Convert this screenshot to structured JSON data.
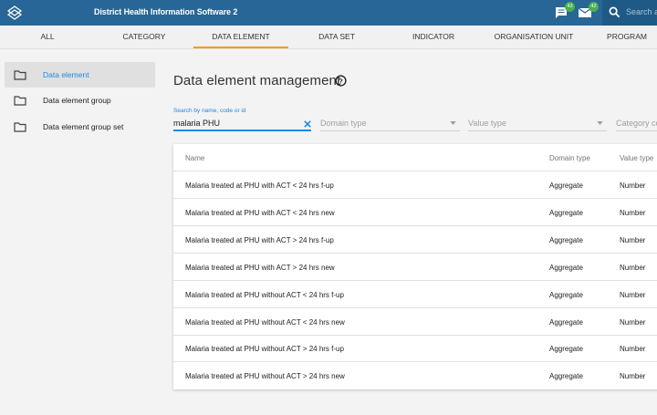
{
  "header": {
    "title": "District Health Information Software 2",
    "messages_badge": "43",
    "interpretations_badge": "42",
    "search_placeholder": "Search apps",
    "logo_icon": "dhis2-logo-icon",
    "messages_icon": "chat-icon",
    "mail_icon": "mail-icon"
  },
  "tabs": [
    {
      "label": "ALL"
    },
    {
      "label": "CATEGORY"
    },
    {
      "label": "DATA ELEMENT"
    },
    {
      "label": "DATA SET"
    },
    {
      "label": "INDICATOR"
    },
    {
      "label": "ORGANISATION UNIT"
    },
    {
      "label": "PROGRAM"
    }
  ],
  "sidebar": {
    "items": [
      {
        "label": "Data element",
        "active": true
      },
      {
        "label": "Data element group"
      },
      {
        "label": "Data element group set"
      }
    ]
  },
  "main": {
    "title": "Data element management",
    "search_label": "Search by name, code or id",
    "search_value": "malaria PHU",
    "filters": {
      "domain_type": "Domain type",
      "value_type": "Value type",
      "category_combo": "Category combo"
    },
    "table": {
      "headers": {
        "name": "Name",
        "domain_type": "Domain type",
        "value_type": "Value type"
      },
      "rows": [
        {
          "name": "Malaria treated at PHU with ACT < 24 hrs f-up",
          "domain_type": "Aggregate",
          "value_type": "Number"
        },
        {
          "name": "Malaria treated at PHU with ACT < 24 hrs new",
          "domain_type": "Aggregate",
          "value_type": "Number"
        },
        {
          "name": "Malaria treated at PHU with ACT > 24 hrs f-up",
          "domain_type": "Aggregate",
          "value_type": "Number"
        },
        {
          "name": "Malaria treated at PHU with ACT > 24 hrs new",
          "domain_type": "Aggregate",
          "value_type": "Number"
        },
        {
          "name": "Malaria treated at PHU without ACT < 24 hrs f-up",
          "domain_type": "Aggregate",
          "value_type": "Number"
        },
        {
          "name": "Malaria treated at PHU without ACT < 24 hrs new",
          "domain_type": "Aggregate",
          "value_type": "Number"
        },
        {
          "name": "Malaria treated at PHU without ACT > 24 hrs f-up",
          "domain_type": "Aggregate",
          "value_type": "Number"
        },
        {
          "name": "Malaria treated at PHU without ACT > 24 hrs new",
          "domain_type": "Aggregate",
          "value_type": "Number"
        }
      ]
    }
  },
  "colors": {
    "header_bg": "#276696",
    "accent_blue": "#1e88e5",
    "tab_underline": "#ff9800",
    "badge": "#4caf50"
  }
}
